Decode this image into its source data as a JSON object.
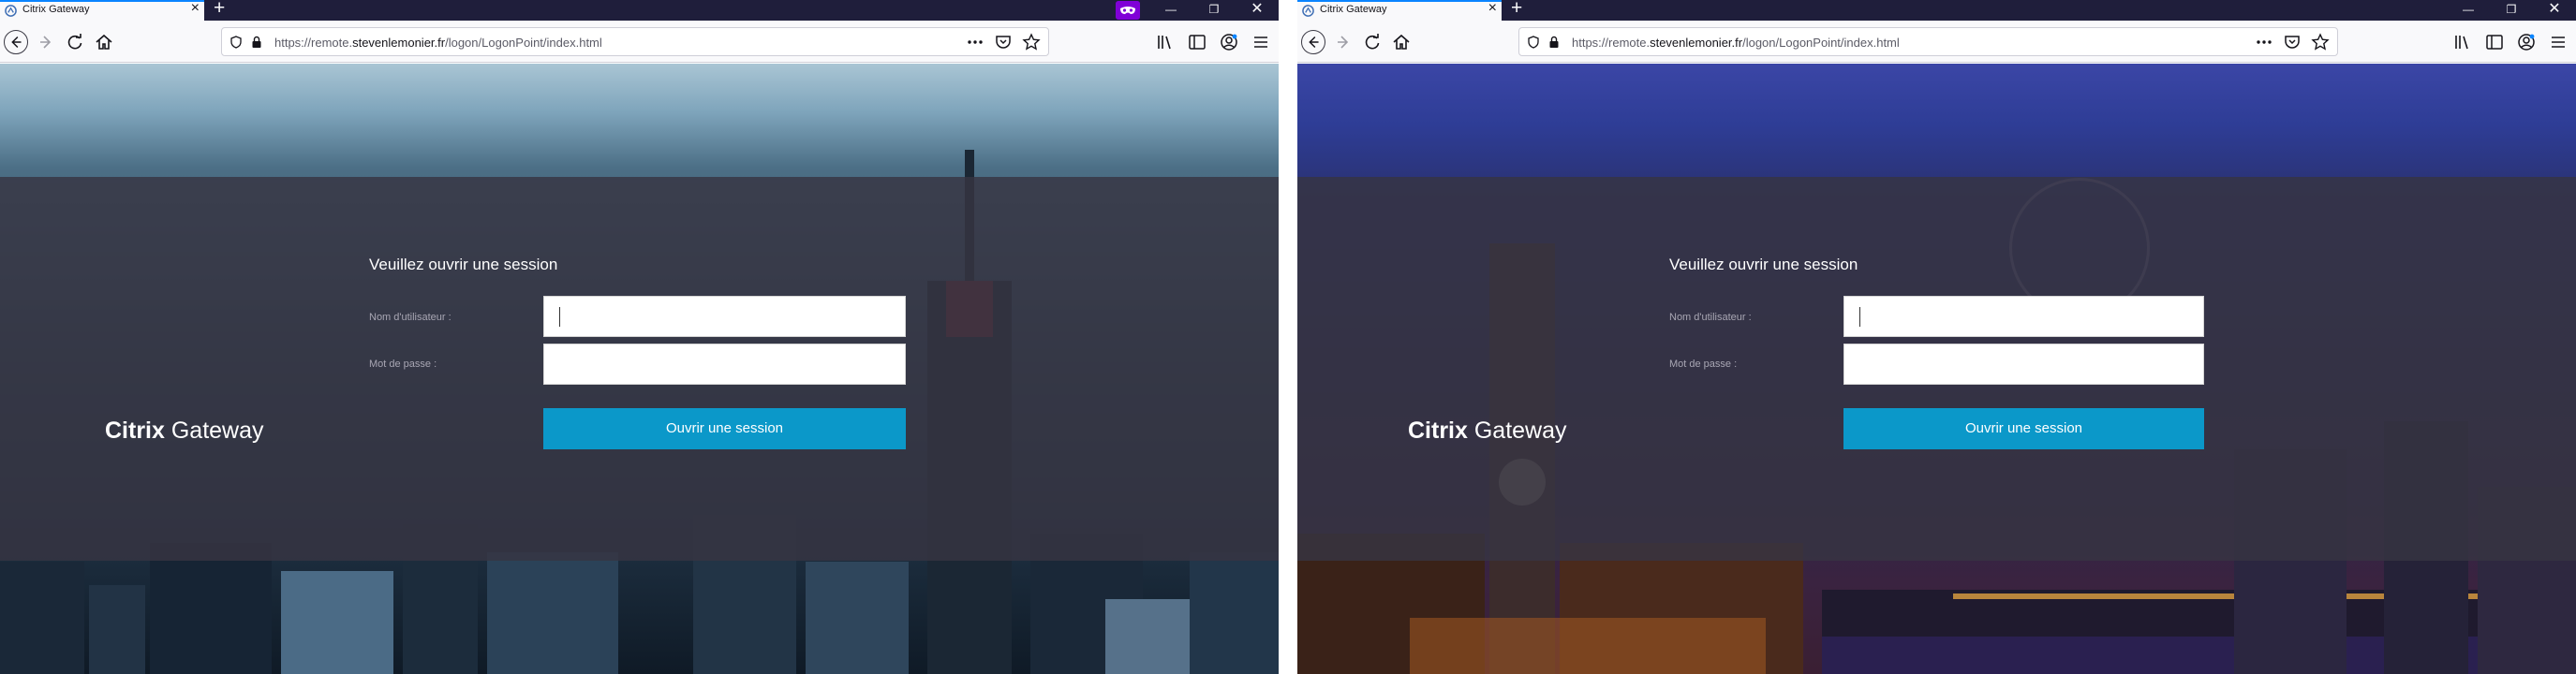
{
  "windows": [
    {
      "tab": {
        "title": "Citrix Gateway"
      },
      "url": {
        "prefix": "https://remote.",
        "domain": "stevenlemonier.fr",
        "path": "/logon/LogonPoint/index.html"
      },
      "private_browsing": true,
      "page": {
        "brand_bold": "Citrix",
        "brand_rest": "Gateway",
        "title": "Veuillez ouvrir une session",
        "username_label": "Nom d'utilisateur :",
        "password_label": "Mot de passe :",
        "username_value": "",
        "password_value": "",
        "submit_label": "Ouvrir une session",
        "background": "New York skyline at dusk"
      }
    },
    {
      "tab": {
        "title": "Citrix Gateway"
      },
      "url": {
        "prefix": "https://remote.",
        "domain": "stevenlemonier.fr",
        "path": "/logon/LogonPoint/index.html"
      },
      "private_browsing": false,
      "page": {
        "brand_bold": "Citrix",
        "brand_rest": "Gateway",
        "title": "Veuillez ouvrir une session",
        "username_label": "Nom d'utilisateur :",
        "password_label": "Mot de passe :",
        "username_value": "",
        "password_value": "",
        "submit_label": "Ouvrir une session",
        "background": "London skyline at night"
      }
    }
  ],
  "colors": {
    "tabstrip": "#1f1e3b",
    "accent": "#0a84ff",
    "submit_button": "#0b98c9",
    "overlay": "#373442",
    "private_badge": "#8000d7"
  },
  "icons": {
    "tab": [
      "citrix-favicon",
      "close-icon",
      "plus-icon"
    ],
    "toolbar": [
      "back-arrow-icon",
      "forward-arrow-icon",
      "reload-icon",
      "home-icon",
      "shield-icon",
      "lock-icon",
      "more-dots-icon",
      "pocket-icon",
      "star-icon",
      "library-icon",
      "sidebar-icon",
      "account-icon",
      "menu-icon"
    ],
    "window": [
      "minimize-icon",
      "restore-icon",
      "close-icon"
    ]
  }
}
